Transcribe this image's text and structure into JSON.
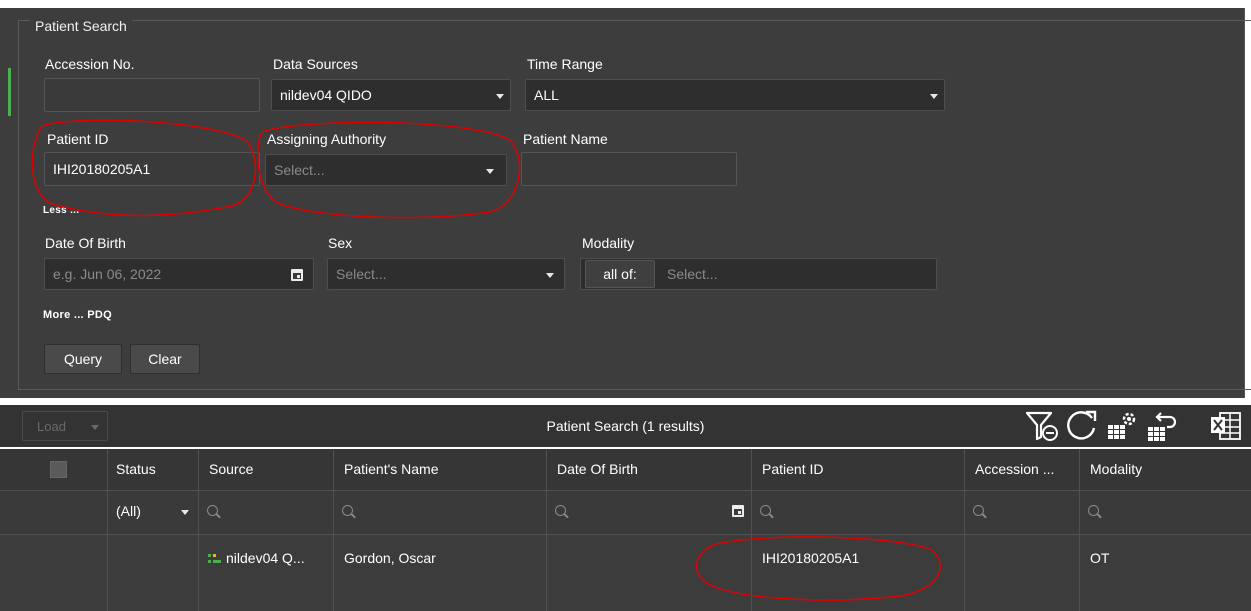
{
  "search": {
    "legend": "Patient Search",
    "accession_label": "Accession No.",
    "accession_value": "",
    "data_sources_label": "Data Sources",
    "data_sources_value": "nildev04 QIDO",
    "time_range_label": "Time Range",
    "time_range_value": "ALL",
    "patient_id_label": "Patient ID",
    "patient_id_value": "IHI20180205A1",
    "assigning_authority_label": "Assigning Authority",
    "assigning_authority_placeholder": "Select...",
    "patient_name_label": "Patient Name",
    "patient_name_value": "",
    "less_link": "Less ...",
    "dob_label": "Date Of Birth",
    "dob_placeholder": "e.g. Jun 06, 2022",
    "sex_label": "Sex",
    "sex_placeholder": "Select...",
    "modality_label": "Modality",
    "modality_mode": "all of:",
    "modality_placeholder": "Select...",
    "more_link": "More ... PDQ",
    "query_button": "Query",
    "clear_button": "Clear"
  },
  "toolbar": {
    "load_button": "Load",
    "title": "Patient Search (1 results)",
    "icons": [
      "clear-filter-icon",
      "refresh-icon",
      "grid-settings-icon",
      "grid-reset-icon",
      "excel-export-icon"
    ]
  },
  "grid": {
    "columns": [
      "Status",
      "Source",
      "Patient's Name",
      "Date Of Birth",
      "Patient ID",
      "Accession ...",
      "Modality"
    ],
    "status_filter": "(All)",
    "rows": [
      {
        "status": "",
        "source": "nildev04 Q...",
        "patient_name": "Gordon, Oscar",
        "date_of_birth": "",
        "patient_id": "IHI20180205A1",
        "accession": "",
        "modality": "OT"
      }
    ]
  },
  "colors": {
    "panel_bg": "#3d3d3d",
    "annotation": "#e00000",
    "accent": "#4caf50"
  }
}
